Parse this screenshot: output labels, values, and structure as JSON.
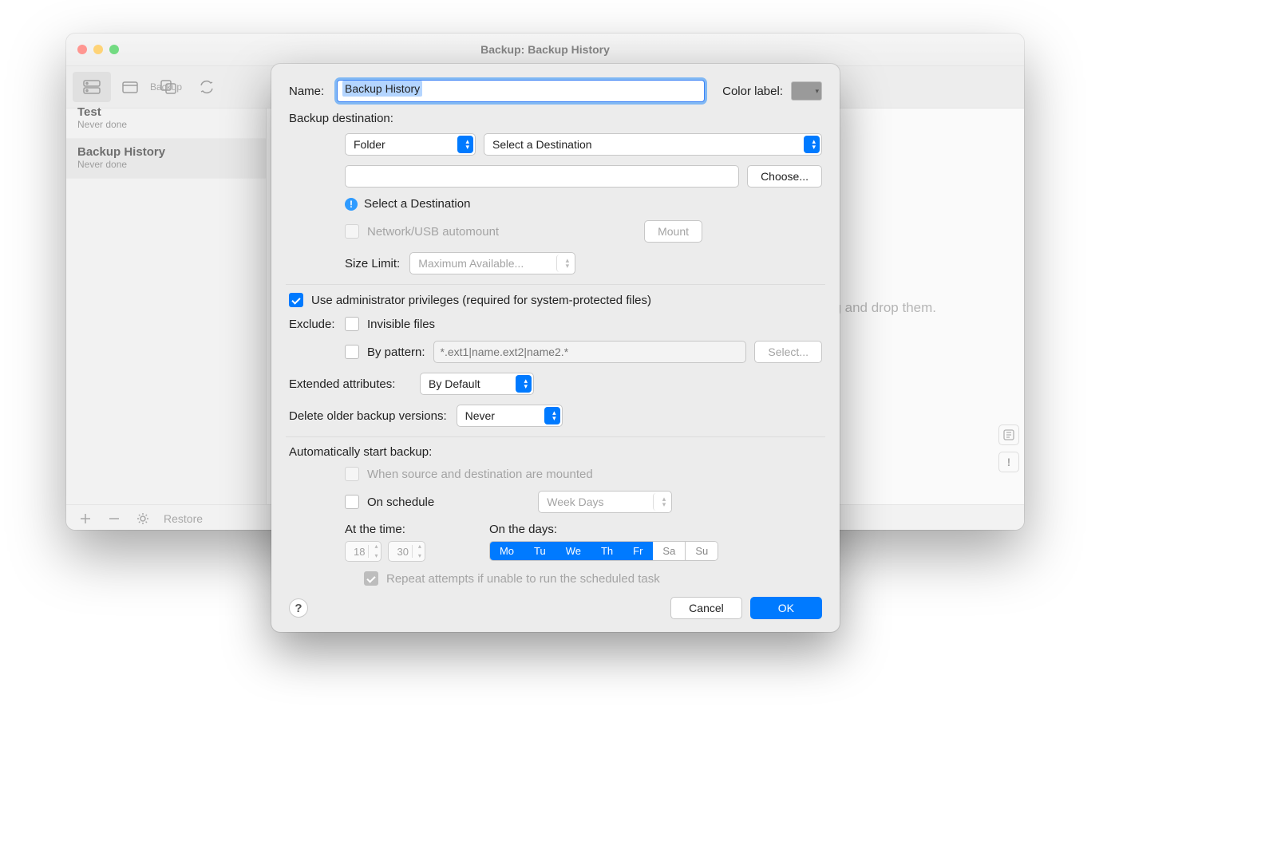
{
  "window": {
    "title": "Backup: Backup History",
    "toolbar_tab_label": "Backup",
    "main_hint": "drag and drop them."
  },
  "sidebar": {
    "items": [
      {
        "name": "Test",
        "subtitle": "Never done"
      },
      {
        "name": "Backup History",
        "subtitle": "Never done"
      }
    ]
  },
  "footer": {
    "restore": "Restore"
  },
  "sheet": {
    "name_label": "Name:",
    "name_value": "Backup History",
    "color_label_text": "Color label:",
    "section_dest": "Backup destination:",
    "dest_type": "Folder",
    "dest_select": "Select a Destination",
    "choose": "Choose...",
    "alert_text": "Select a Destination",
    "automount_label": "Network/USB automount",
    "mount_btn": "Mount",
    "size_limit_label": "Size Limit:",
    "size_limit_value": "Maximum Available...",
    "admin_privs": "Use administrator privileges (required for system-protected files)",
    "exclude_label": "Exclude:",
    "exclude_invisible": "Invisible files",
    "exclude_pattern_label": "By pattern:",
    "pattern_placeholder": "*.ext1|name.ext2|name2.*",
    "select_btn": "Select...",
    "xattr_label": "Extended attributes:",
    "xattr_value": "By Default",
    "delete_older_label": "Delete older backup versions:",
    "delete_older_value": "Never",
    "auto_start_label": "Automatically start backup:",
    "when_mounted": "When source and destination are mounted",
    "on_schedule": "On schedule",
    "schedule_value": "Week Days",
    "at_time_label": "At the time:",
    "time_h": "18",
    "time_m": "30",
    "on_days_label": "On the days:",
    "days": [
      "Mo",
      "Tu",
      "We",
      "Th",
      "Fr",
      "Sa",
      "Su"
    ],
    "days_selected": [
      true,
      true,
      true,
      true,
      true,
      false,
      false
    ],
    "repeat_label": "Repeat attempts if unable to run the scheduled task",
    "cancel": "Cancel",
    "ok": "OK"
  }
}
